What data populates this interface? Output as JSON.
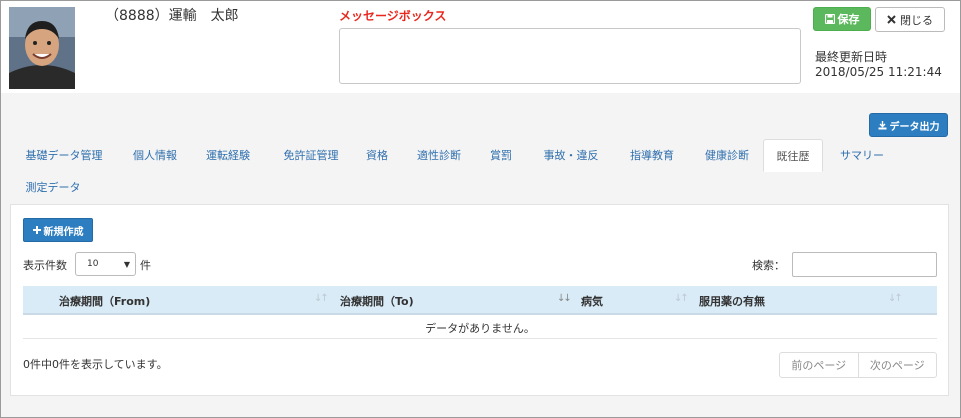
{
  "header": {
    "user_name": "（8888）運輸　太郎",
    "message_label": "メッセージボックス",
    "save_label": "保存",
    "close_label": "閉じる",
    "last_updated_label": "最終更新日時",
    "last_updated_value": "2018/05/25 11:21:44"
  },
  "toolbar": {
    "export_label": "データ出力"
  },
  "tabs": [
    {
      "label": "基礎データ管理"
    },
    {
      "label": "個人情報"
    },
    {
      "label": "運転経験"
    },
    {
      "label": "免許証管理"
    },
    {
      "label": "資格"
    },
    {
      "label": "適性診断"
    },
    {
      "label": "賞罰"
    },
    {
      "label": "事故・違反"
    },
    {
      "label": "指導教育"
    },
    {
      "label": "健康診断"
    },
    {
      "label": "既往歴",
      "active": true
    },
    {
      "label": "サマリー"
    },
    {
      "label": "測定データ"
    }
  ],
  "panel": {
    "new_label": "新規作成",
    "length_label": "表示件数",
    "length_value": "10",
    "length_unit": "件",
    "search_label": "検索：",
    "columns": [
      "治療期間（From)",
      "治療期間（To)",
      "病気",
      "服用薬の有無"
    ],
    "empty_text": "データがありません。",
    "info_text": "0件中0件を表示しています。",
    "prev_label": "前のページ",
    "next_label": "次のページ"
  },
  "colors": {
    "save": "#5cb85c",
    "primary": "#2d7ec0",
    "message_label": "#e8281e",
    "table_header": "#d9ebf7",
    "tab_link": "#2f6fae"
  },
  "icons": {
    "save": "floppy-icon",
    "close": "close-icon",
    "export": "download-icon",
    "new": "plus-icon"
  }
}
